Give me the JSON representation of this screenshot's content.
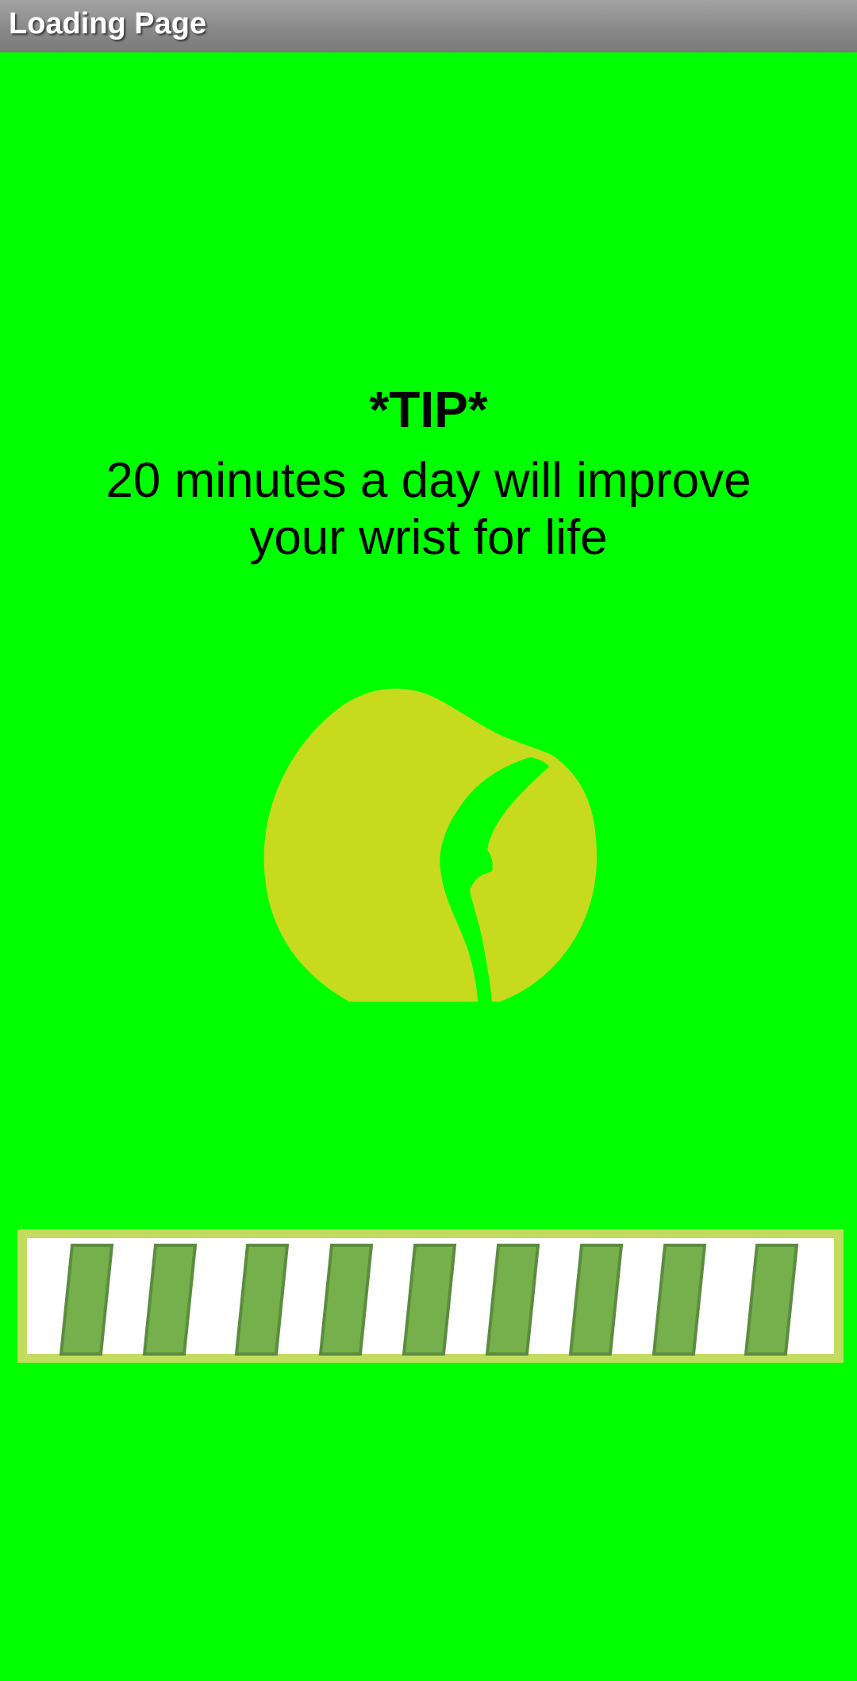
{
  "window": {
    "title": "Loading Page"
  },
  "tip": {
    "heading": "*TIP*",
    "text": "20 minutes a day will improve your wrist for life"
  },
  "colors": {
    "background": "#00ff00",
    "ball": "#c8da1e",
    "progress_frame": "#c3db5e",
    "progress_stripe": "#76b04c",
    "progress_stripe_outline": "#5c8c3e"
  },
  "icons": {
    "ball": "tennis-ball-icon"
  },
  "progress": {
    "state": "indeterminate"
  }
}
